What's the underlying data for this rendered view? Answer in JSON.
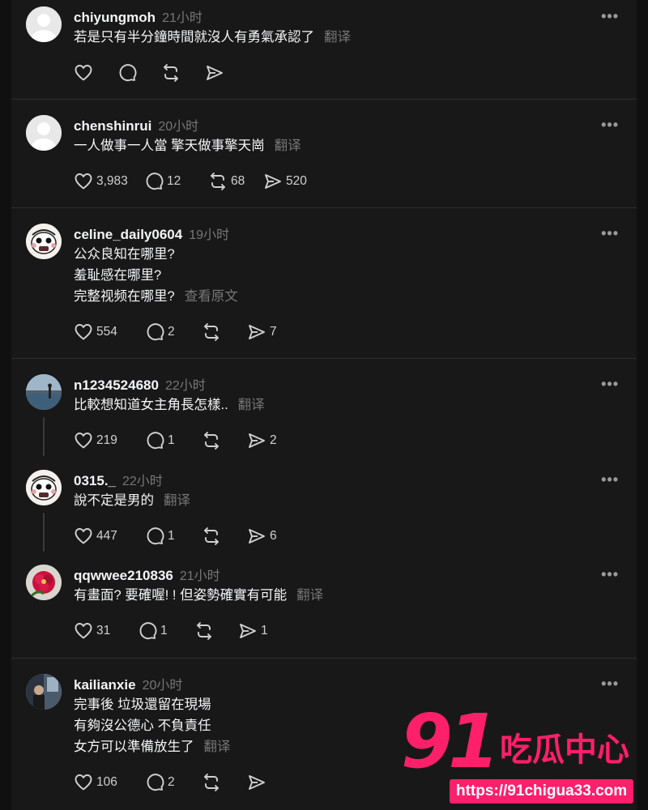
{
  "posts": [
    {
      "username": "chiyungmoh",
      "time": "21小时",
      "lines": [
        "若是只有半分鐘時間就沒人有勇氣承認了"
      ],
      "translate_label": "翻译",
      "stats": {
        "likes": "",
        "replies": "",
        "reposts": "",
        "shares": ""
      },
      "avatar": "default"
    },
    {
      "username": "chenshinrui",
      "time": "20小时",
      "lines": [
        "一人做事一人當 擎天做事擎天崗"
      ],
      "translate_label": "翻译",
      "stats": {
        "likes": "3,983",
        "replies": "12",
        "reposts": "68",
        "shares": "520"
      },
      "avatar": "default"
    },
    {
      "username": "celine_daily0604",
      "time": "19小时",
      "lines": [
        "公众良知在哪里?",
        "羞耻感在哪里?",
        "完整视频在哪里?"
      ],
      "translate_label": "查看原文",
      "stats": {
        "likes": "554",
        "replies": "2",
        "reposts": "",
        "shares": "7"
      },
      "avatar": "cartoon"
    },
    {
      "username": "n1234524680",
      "time": "22小时",
      "lines": [
        "比較想知道女主角長怎樣.."
      ],
      "translate_label": "翻译",
      "stats": {
        "likes": "219",
        "replies": "1",
        "reposts": "",
        "shares": "2"
      },
      "avatar": "lake"
    },
    {
      "username": "0315._",
      "time": "22小时",
      "lines": [
        "說不定是男的"
      ],
      "translate_label": "翻译",
      "stats": {
        "likes": "447",
        "replies": "1",
        "reposts": "",
        "shares": "6"
      },
      "avatar": "cartoon"
    },
    {
      "username": "qqwwee210836",
      "time": "21小时",
      "lines": [
        "有畫面? 要確喔! ! 但姿勢確實有可能"
      ],
      "translate_label": "翻译",
      "stats": {
        "likes": "31",
        "replies": "1",
        "reposts": "",
        "shares": "1"
      },
      "avatar": "flower"
    },
    {
      "username": "kailianxie",
      "time": "20小时",
      "lines": [
        "完事後 垃圾還留在現場",
        "有夠沒公德心 不負責任",
        "女方可以準備放生了"
      ],
      "translate_label": "翻译",
      "stats": {
        "likes": "106",
        "replies": "2",
        "reposts": "",
        "shares": ""
      },
      "avatar": "room"
    }
  ],
  "more_icon": "•••",
  "icons": [
    "heart-icon",
    "comment-icon",
    "repost-icon",
    "share-icon",
    "more-options-icon"
  ],
  "watermark": {
    "number": "91",
    "name": "吃瓜中心",
    "url": "https://91chigua33.com"
  },
  "colors": {
    "background": "#181818",
    "text": "#f3f5f7",
    "muted": "#777777",
    "watermark": "#ff1f6b"
  }
}
